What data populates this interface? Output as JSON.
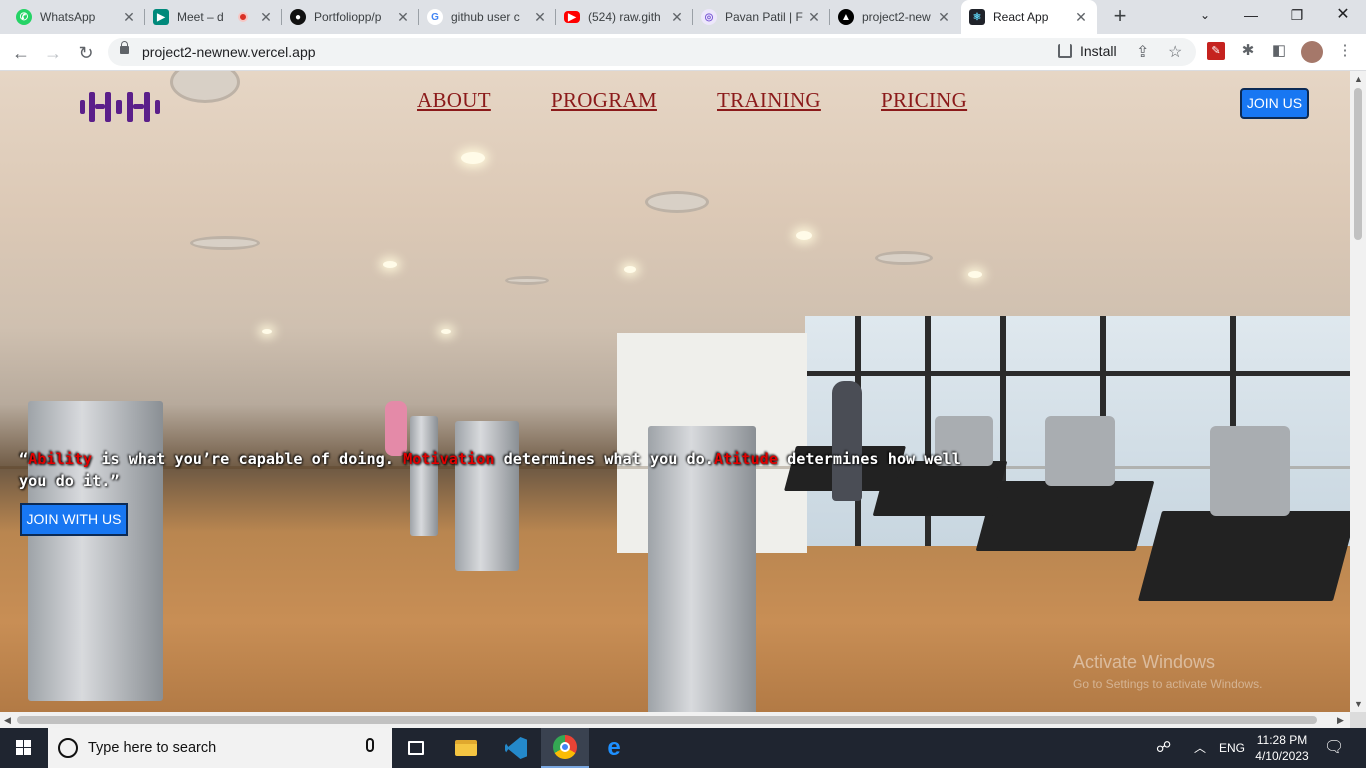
{
  "browser": {
    "tabs": [
      {
        "title": "WhatsApp",
        "fav_color": "#25d366",
        "icon": "whatsapp-icon"
      },
      {
        "title": "Meet – d",
        "fav_color": "#00897b",
        "icon": "meet-icon",
        "recording": true
      },
      {
        "title": "Portfoliopp/p",
        "fav_color": "#111111",
        "icon": "github-icon"
      },
      {
        "title": "github user c",
        "fav_color": "#4285f4",
        "icon": "google-icon"
      },
      {
        "title": "(524) raw.gith",
        "fav_color": "#ff0000",
        "icon": "youtube-icon"
      },
      {
        "title": "Pavan Patil | F",
        "fav_color": "#7c5cd6",
        "icon": "portfolio-icon"
      },
      {
        "title": "project2-new",
        "fav_color": "#000000",
        "icon": "vercel-icon"
      },
      {
        "title": "React App",
        "fav_color": "#20232a",
        "icon": "react-icon",
        "active": true
      }
    ],
    "url": "project2-newnew.vercel.app",
    "install_label": "Install"
  },
  "site": {
    "nav": {
      "about": "ABOUT",
      "program": "PROGRAM",
      "training": "TRAINING",
      "pricing": "PRICING"
    },
    "join_label": "JOIN US",
    "quote": {
      "open": "“",
      "word1": "Ability",
      "part1": " is what you’re capable of doing. ",
      "word2": "Motivation",
      "part2": " determines what you do.",
      "word3": "Atitude",
      "part3": " determines how well you do it.”"
    },
    "cta_label": "JOIN WITH US",
    "accent_color": "#1877f2",
    "nav_color": "#8b1a1a",
    "highlight_color": "#e00000"
  },
  "watermark": {
    "title": "Activate Windows",
    "subtitle": "Go to Settings to activate Windows."
  },
  "taskbar": {
    "search_placeholder": "Type here to search",
    "lang": "ENG",
    "time": "11:28 PM",
    "date": "4/10/2023"
  }
}
